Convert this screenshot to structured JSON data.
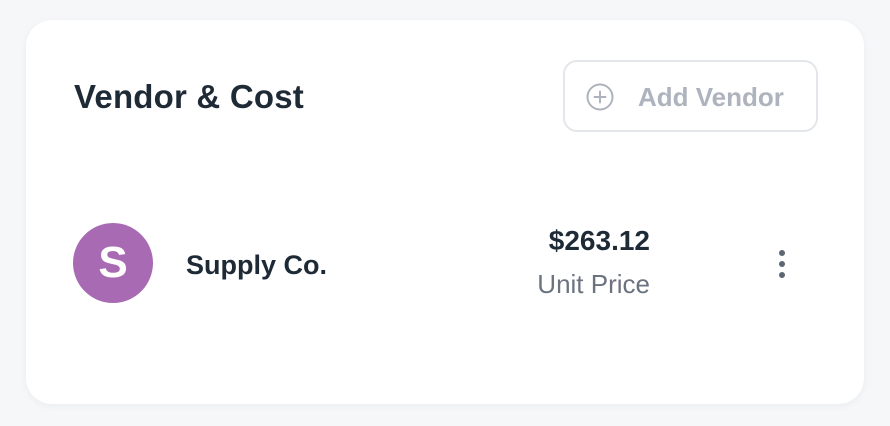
{
  "card": {
    "title": "Vendor & Cost",
    "add_button": {
      "label": "Add Vendor",
      "icon": "plus-circle-icon"
    }
  },
  "vendors": [
    {
      "initial": "S",
      "name": "Supply Co.",
      "price": "$263.12",
      "price_label": "Unit Price",
      "avatar_color": "#a86ab3",
      "menu_icon": "more-vertical-icon"
    }
  ],
  "colors": {
    "title_text": "#1f2a37",
    "muted_text": "#6b7380",
    "button_text": "#aeb4bd",
    "button_border": "#e3e6ea",
    "card_background": "#ffffff",
    "page_background": "#f6f7f9"
  }
}
